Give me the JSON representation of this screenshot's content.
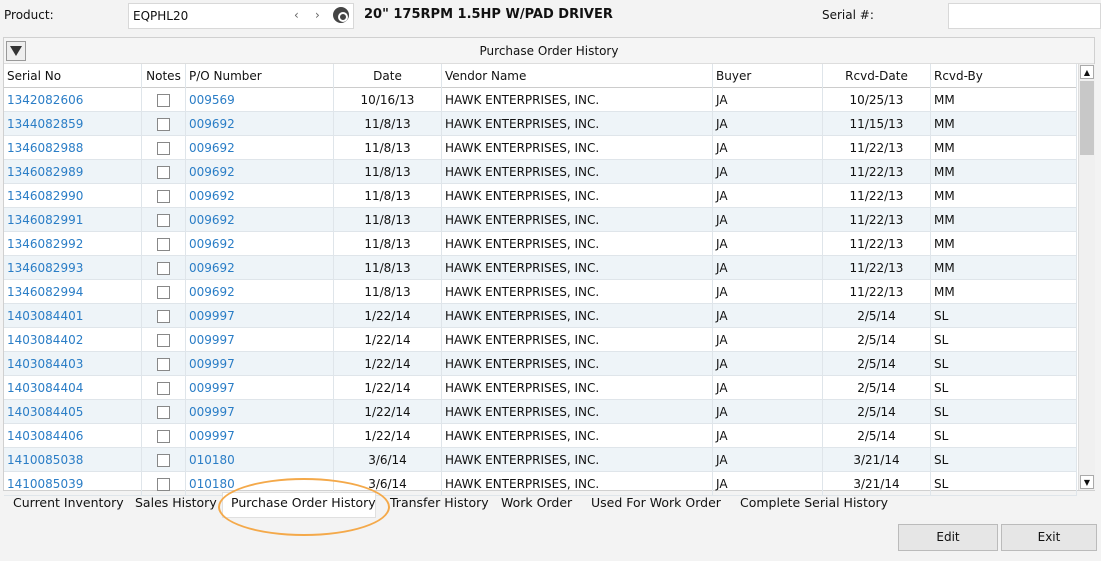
{
  "header": {
    "product_label": "Product:",
    "product_value": "EQPHL20",
    "prev": "‹",
    "next": "›",
    "description": "20\" 175RPM 1.5HP W/PAD DRIVER",
    "serial_label": "Serial #:",
    "serial_value": ""
  },
  "grid": {
    "title": "Purchase Order History",
    "columns": [
      "Serial No",
      "Notes",
      "P/O Number",
      "Date",
      "Vendor Name",
      "Buyer",
      "Rcvd-Date",
      "Rcvd-By"
    ],
    "rows": [
      [
        "1342082606",
        "009569",
        "10/16/13",
        "HAWK ENTERPRISES, INC.",
        "JA",
        "10/25/13",
        "MM"
      ],
      [
        "1344082859",
        "009692",
        "11/8/13",
        "HAWK ENTERPRISES, INC.",
        "JA",
        "11/15/13",
        "MM"
      ],
      [
        "1346082988",
        "009692",
        "11/8/13",
        "HAWK ENTERPRISES, INC.",
        "JA",
        "11/22/13",
        "MM"
      ],
      [
        "1346082989",
        "009692",
        "11/8/13",
        "HAWK ENTERPRISES, INC.",
        "JA",
        "11/22/13",
        "MM"
      ],
      [
        "1346082990",
        "009692",
        "11/8/13",
        "HAWK ENTERPRISES, INC.",
        "JA",
        "11/22/13",
        "MM"
      ],
      [
        "1346082991",
        "009692",
        "11/8/13",
        "HAWK ENTERPRISES, INC.",
        "JA",
        "11/22/13",
        "MM"
      ],
      [
        "1346082992",
        "009692",
        "11/8/13",
        "HAWK ENTERPRISES, INC.",
        "JA",
        "11/22/13",
        "MM"
      ],
      [
        "1346082993",
        "009692",
        "11/8/13",
        "HAWK ENTERPRISES, INC.",
        "JA",
        "11/22/13",
        "MM"
      ],
      [
        "1346082994",
        "009692",
        "11/8/13",
        "HAWK ENTERPRISES, INC.",
        "JA",
        "11/22/13",
        "MM"
      ],
      [
        "1403084401",
        "009997",
        "1/22/14",
        "HAWK ENTERPRISES, INC.",
        "JA",
        "2/5/14",
        "SL"
      ],
      [
        "1403084402",
        "009997",
        "1/22/14",
        "HAWK ENTERPRISES, INC.",
        "JA",
        "2/5/14",
        "SL"
      ],
      [
        "1403084403",
        "009997",
        "1/22/14",
        "HAWK ENTERPRISES, INC.",
        "JA",
        "2/5/14",
        "SL"
      ],
      [
        "1403084404",
        "009997",
        "1/22/14",
        "HAWK ENTERPRISES, INC.",
        "JA",
        "2/5/14",
        "SL"
      ],
      [
        "1403084405",
        "009997",
        "1/22/14",
        "HAWK ENTERPRISES, INC.",
        "JA",
        "2/5/14",
        "SL"
      ],
      [
        "1403084406",
        "009997",
        "1/22/14",
        "HAWK ENTERPRISES, INC.",
        "JA",
        "2/5/14",
        "SL"
      ],
      [
        "1410085038",
        "010180",
        "3/6/14",
        "HAWK ENTERPRISES, INC.",
        "JA",
        "3/21/14",
        "SL"
      ],
      [
        "1410085039",
        "010180",
        "3/6/14",
        "HAWK ENTERPRISES, INC.",
        "JA",
        "3/21/14",
        "SL"
      ]
    ]
  },
  "tabs": [
    "Current Inventory",
    "Sales History",
    "Purchase Order History",
    "Transfer History",
    "Work Order",
    "Used For Work Order",
    "Complete Serial History"
  ],
  "active_tab": "Purchase Order History",
  "buttons": {
    "edit": "Edit",
    "exit": "Exit"
  },
  "colors": {
    "link": "#2a7dc6",
    "highlight_ring": "#f4a94a",
    "alt_row": "#eef4f8"
  }
}
